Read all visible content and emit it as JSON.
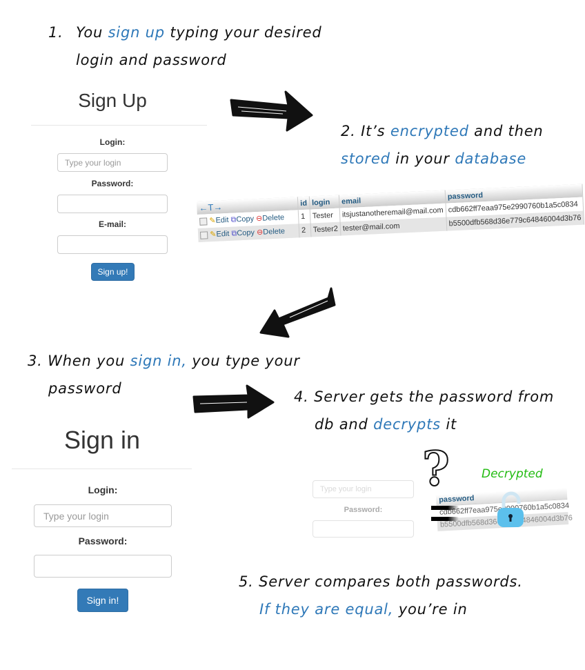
{
  "steps": [
    {
      "num": "1.",
      "line1": [
        {
          "t": "You "
        },
        {
          "t": "sign up",
          "hl": true
        },
        {
          "t": " typing your desired"
        }
      ],
      "line2": [
        {
          "t": "login and password"
        }
      ]
    },
    {
      "num": "2.",
      "line1": [
        {
          "t": "It’s "
        },
        {
          "t": "encrypted",
          "hl": true
        },
        {
          "t": " and then"
        }
      ],
      "line2": [
        {
          "t": "stored",
          "hl": true
        },
        {
          "t": " in your "
        },
        {
          "t": "database",
          "hl": true
        }
      ]
    },
    {
      "num": "3.",
      "line1": [
        {
          "t": "When you "
        },
        {
          "t": "sign in,",
          "hl": true
        },
        {
          "t": " you type your"
        }
      ],
      "line2": [
        {
          "t": "password"
        }
      ]
    },
    {
      "num": "4.",
      "line1": [
        {
          "t": "Server gets the password from"
        }
      ],
      "line2": [
        {
          "t": "db and "
        },
        {
          "t": "decrypts",
          "hl": true
        },
        {
          "t": " it"
        }
      ]
    },
    {
      "num": "5.",
      "line1": [
        {
          "t": "Server compares both passwords."
        }
      ],
      "line2": [
        {
          "t": "If they are equal,",
          "hl": true
        },
        {
          "t": " you’re in"
        }
      ]
    }
  ],
  "signup": {
    "title": "Sign Up",
    "login_label": "Login:",
    "login_placeholder": "Type your login",
    "password_label": "Password:",
    "email_label": "E-mail:",
    "button": "Sign up!"
  },
  "signin": {
    "title": "Sign in",
    "login_label": "Login:",
    "login_placeholder": "Type your login",
    "password_label": "Password:",
    "button": "Sign in!"
  },
  "db_table": {
    "nav": "←T→",
    "columns": [
      "id",
      "login",
      "email",
      "password"
    ],
    "actions": {
      "edit": "Edit",
      "copy": "Copy",
      "delete": "Delete"
    },
    "rows": [
      {
        "id": "1",
        "login": "Tester",
        "email": "itsjustanotheremail@mail.com",
        "password": "cdb662ff7eaa975e2990760b1a5c0834"
      },
      {
        "id": "2",
        "login": "Tester2",
        "email": "tester@mail.com",
        "password": "b5500dfb568d36e779c64846004d3b76"
      }
    ]
  },
  "step4_visual": {
    "faded_login_placeholder": "Type your login",
    "faded_password_label": "Password:",
    "password_header": "password",
    "hash1": "cdb662ff7eaa975e2990760b1a5c0834",
    "hash2": "b5500dfb568d36e779c64846004d3b76",
    "decrypted_label": "Decrypted",
    "decrypted_color": "#22bb11",
    "question_mark": "?"
  },
  "colors": {
    "highlight": "#2e78b8",
    "button": "#337ab7"
  }
}
